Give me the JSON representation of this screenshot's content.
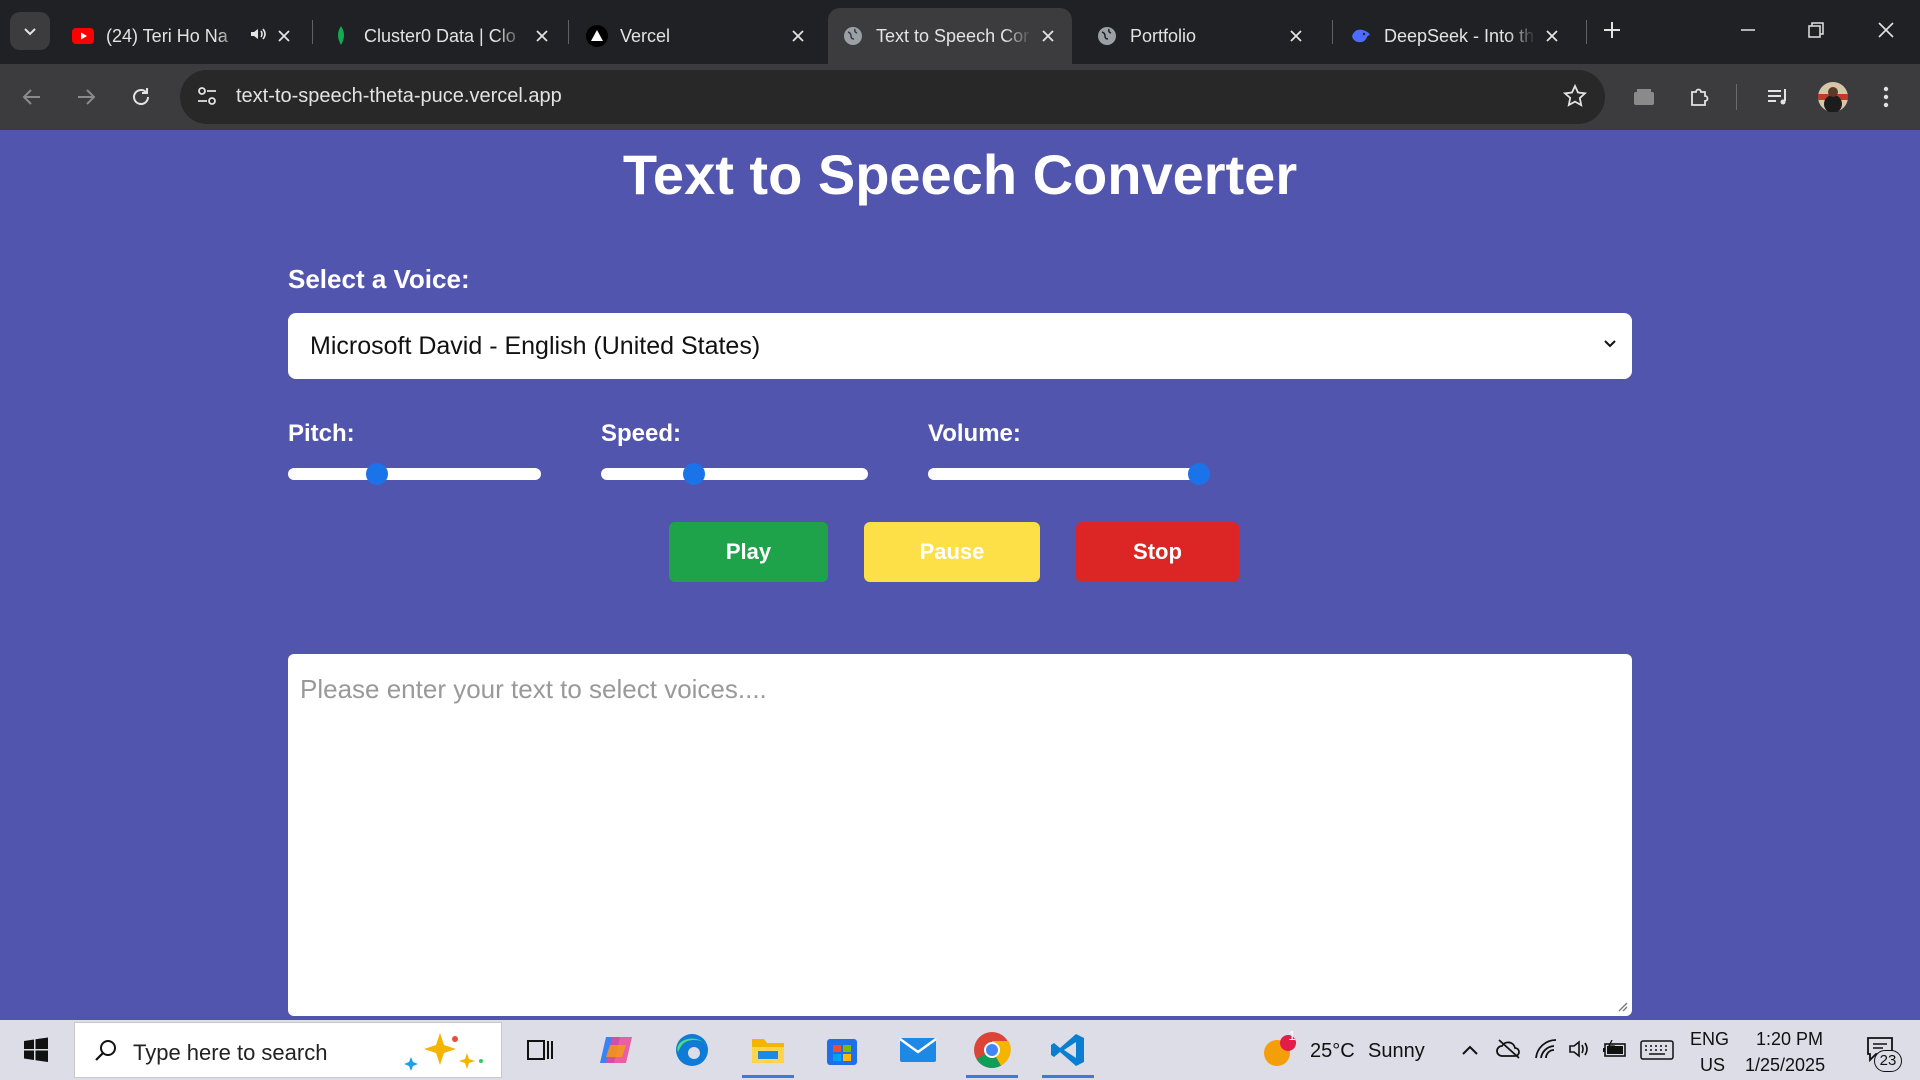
{
  "browser": {
    "tabs": [
      {
        "title": "(24) Teri Ho Na",
        "icon": "youtube-icon",
        "audio": true,
        "active": false
      },
      {
        "title": "Cluster0 Data | Clo",
        "icon": "mongodb-leaf-icon",
        "active": false
      },
      {
        "title": "Vercel",
        "icon": "vercel-triangle-icon",
        "active": false
      },
      {
        "title": "Text to Speech Cor",
        "icon": "globe-icon",
        "active": true
      },
      {
        "title": "Portfolio",
        "icon": "globe-icon",
        "active": false
      },
      {
        "title": "DeepSeek - Into th",
        "icon": "deepseek-whale-icon",
        "active": false
      }
    ],
    "url": "text-to-speech-theta-puce.vercel.app"
  },
  "page": {
    "title": "Text to Speech Converter",
    "voice_label": "Select a Voice:",
    "voice_selected": "Microsoft David - English (United States)",
    "pitch_label": "Pitch:",
    "speed_label": "Speed:",
    "volume_label": "Volume:",
    "pitch_value_fraction": 0.35,
    "speed_value_fraction": 0.35,
    "volume_value_fraction": 1.0,
    "play_label": "Play",
    "pause_label": "Pause",
    "stop_label": "Stop",
    "textarea_placeholder": "Please enter your text to select voices....",
    "colors": {
      "background": "#5255ad",
      "play": "#1fa34a",
      "pause": "#fde047",
      "stop": "#dc2626",
      "slider_thumb": "#1a73e8"
    }
  },
  "taskbar": {
    "search_placeholder": "Type here to search",
    "weather_temp": "25°C",
    "weather_desc": "Sunny",
    "weather_badge": "1",
    "lang_top": "ENG",
    "lang_bottom": "US",
    "time": "1:20 PM",
    "date": "1/25/2025",
    "notification_count": "23"
  }
}
